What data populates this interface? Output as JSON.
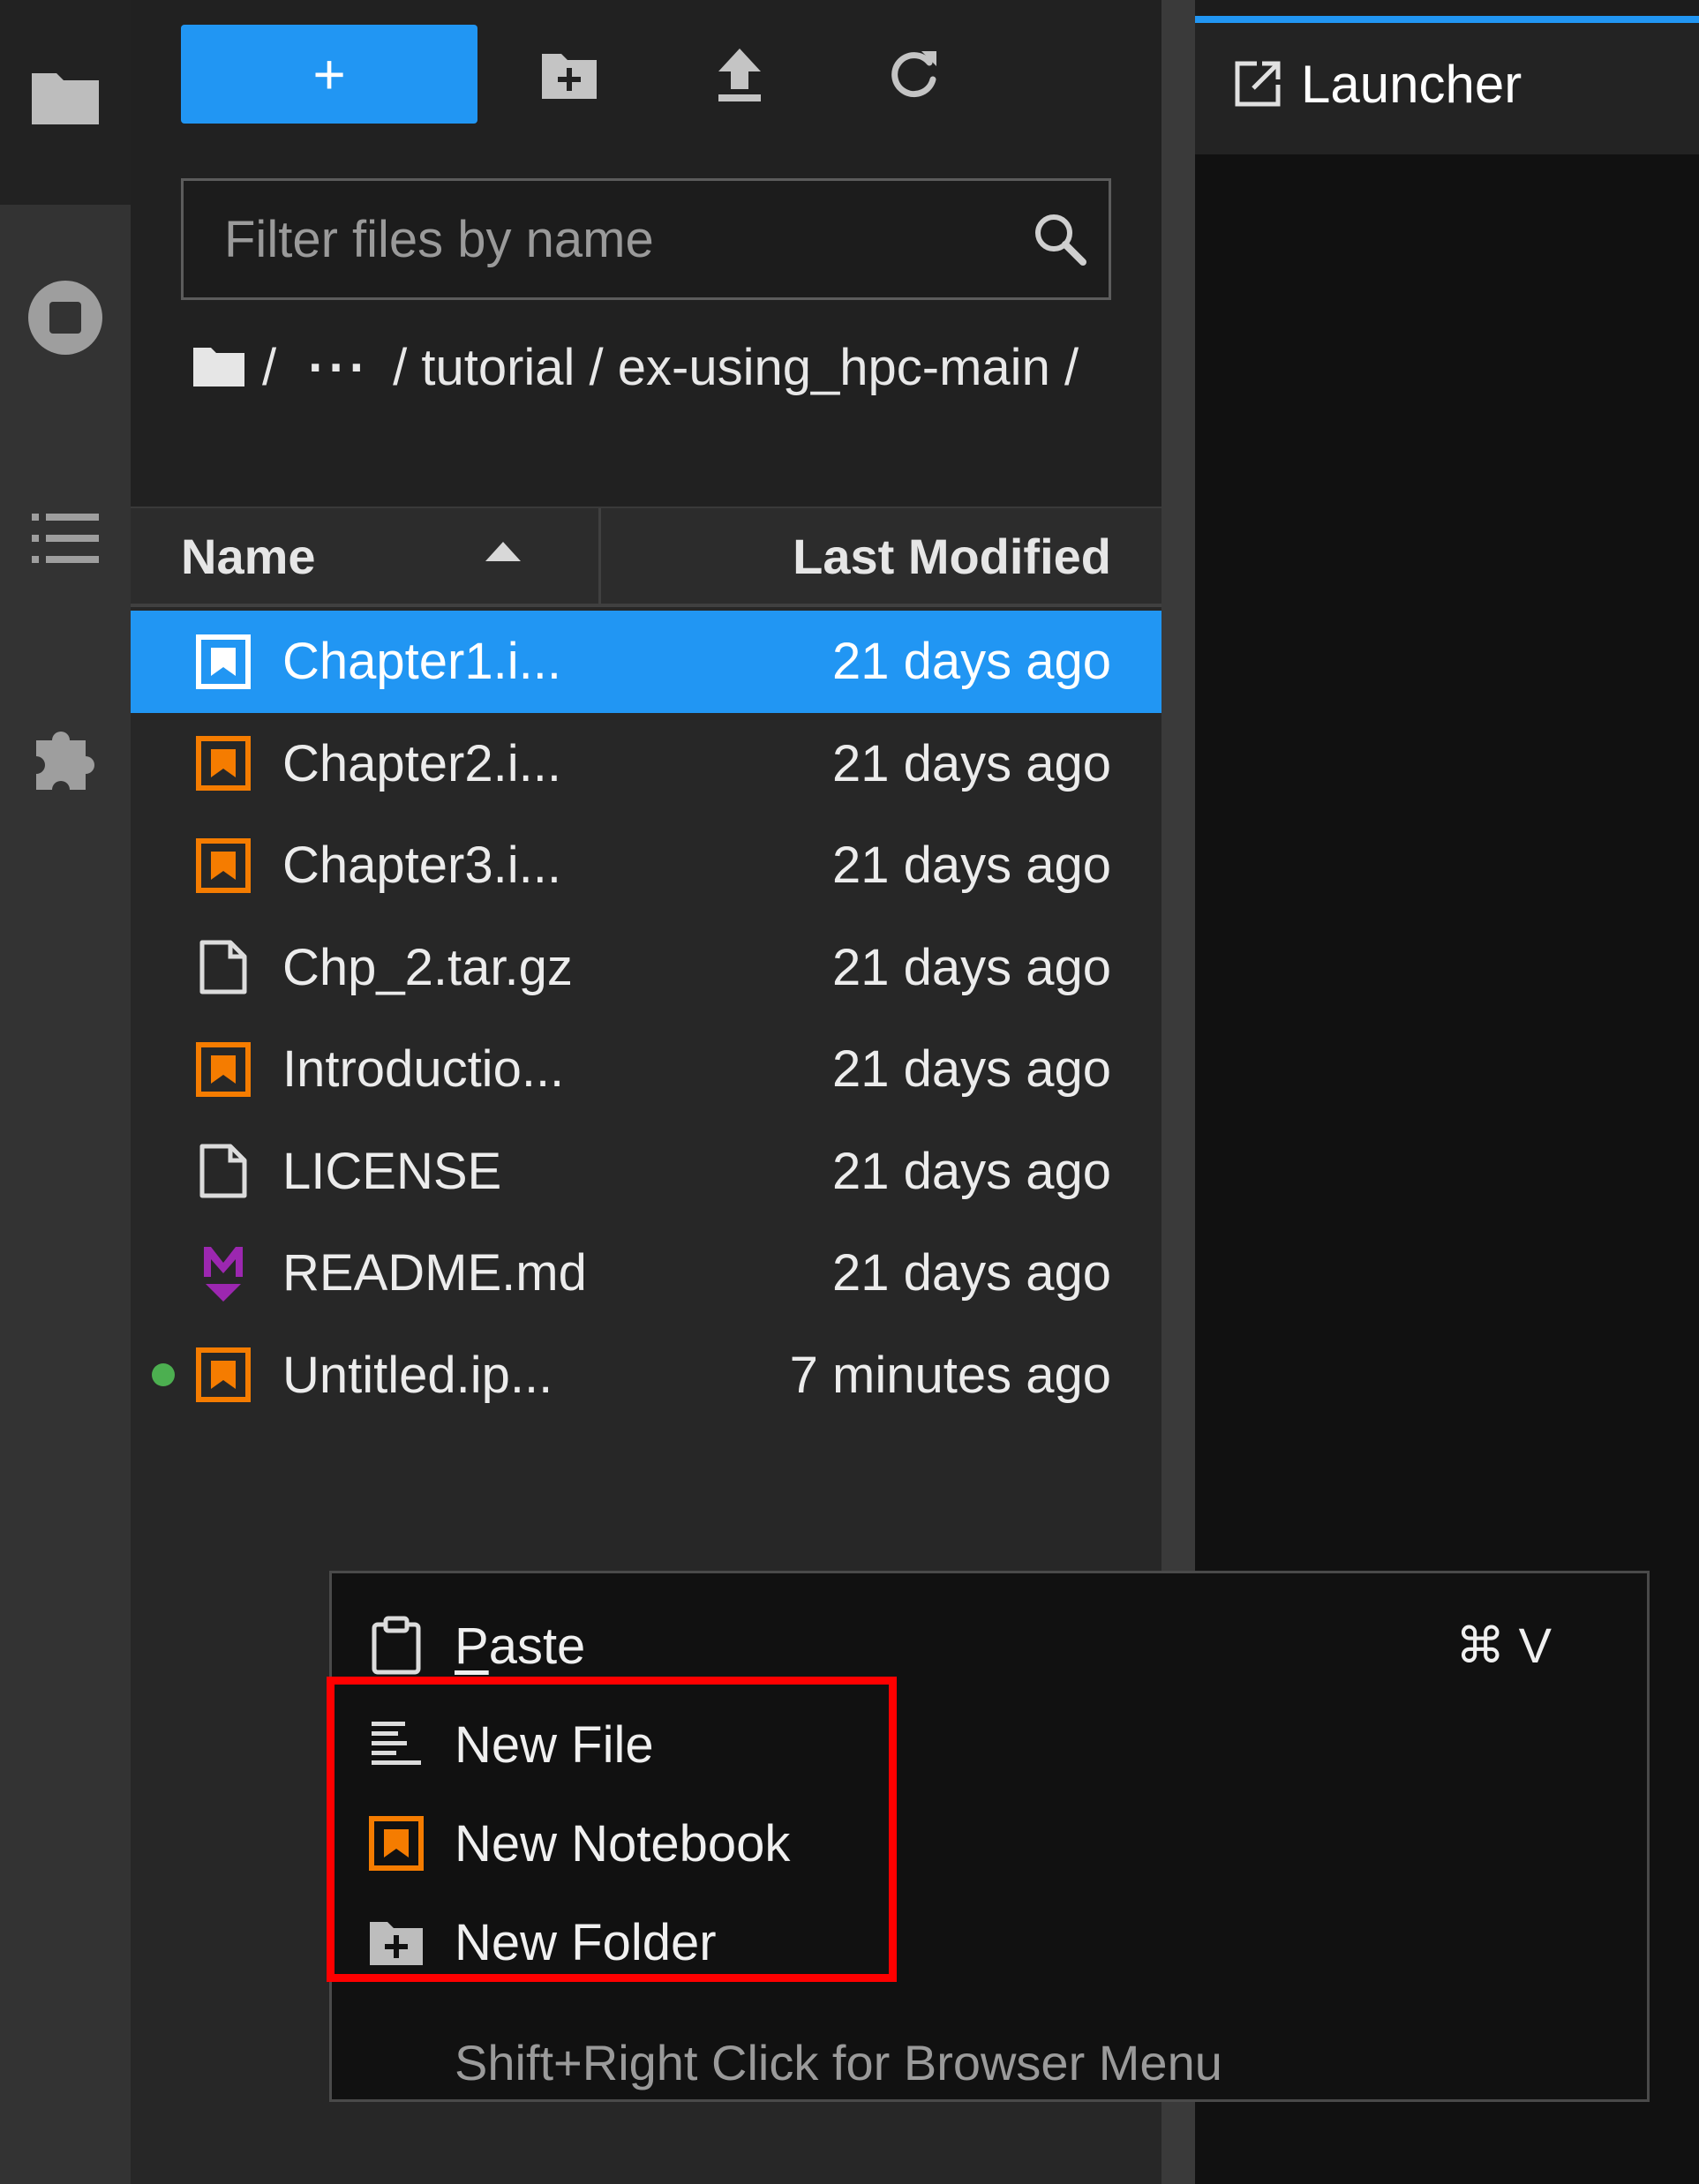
{
  "toolbar": {
    "new_launcher_label": "+",
    "new_folder_icon": "new-folder-icon",
    "upload_icon": "upload-icon",
    "refresh_icon": "refresh-icon"
  },
  "activity_bar": {
    "items": [
      {
        "icon": "folder-icon"
      },
      {
        "icon": "running-sessions-icon"
      },
      {
        "icon": "table-of-contents-icon"
      },
      {
        "icon": "extensions-icon"
      }
    ]
  },
  "filter": {
    "placeholder": "Filter files by name",
    "value": ""
  },
  "breadcrumb": {
    "root_icon": "folder-icon",
    "sep": "/",
    "ellipsis": "···",
    "segment1": "tutorial",
    "segment2": "ex-using_hpc-main"
  },
  "columns": {
    "name": "Name",
    "modified": "Last Modified",
    "sort": "ascending"
  },
  "files": [
    {
      "name": "Chapter1.i...",
      "modified": "21 days ago",
      "type": "notebook",
      "selected": true,
      "running": false
    },
    {
      "name": "Chapter2.i...",
      "modified": "21 days ago",
      "type": "notebook",
      "selected": false,
      "running": false
    },
    {
      "name": "Chapter3.i...",
      "modified": "21 days ago",
      "type": "notebook",
      "selected": false,
      "running": false
    },
    {
      "name": "Chp_2.tar.gz",
      "modified": "21 days ago",
      "type": "file",
      "selected": false,
      "running": false
    },
    {
      "name": "Introductio...",
      "modified": "21 days ago",
      "type": "notebook",
      "selected": false,
      "running": false
    },
    {
      "name": "LICENSE",
      "modified": "21 days ago",
      "type": "file",
      "selected": false,
      "running": false
    },
    {
      "name": "README.md",
      "modified": "21 days ago",
      "type": "markdown",
      "selected": false,
      "running": false
    },
    {
      "name": "Untitled.ip...",
      "modified": "7 minutes ago",
      "type": "notebook",
      "selected": false,
      "running": true
    }
  ],
  "main": {
    "tab_label": "Launcher",
    "tab_icon": "launcher-icon"
  },
  "context_menu": {
    "paste_first": "P",
    "paste_rest": "aste",
    "paste_shortcut": "⌘ V",
    "new_file": "New File",
    "new_notebook": "New Notebook",
    "new_folder": "New Folder",
    "hint": "Shift+Right Click for Browser Menu"
  },
  "colors": {
    "accent": "#2196f3",
    "notebook": "#f57c00",
    "markdown": "#9c27b0",
    "running": "#4caf50",
    "highlight": "#ff0000"
  }
}
